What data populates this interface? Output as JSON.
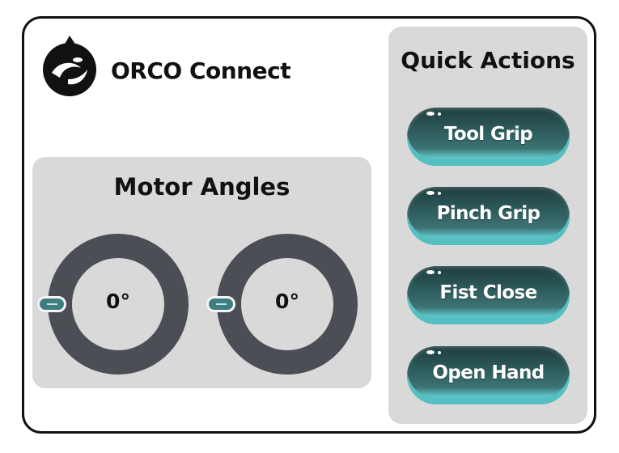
{
  "header": {
    "title": "ORCO Connect",
    "logo_icon": "orca-logo-icon"
  },
  "motors": {
    "title": "Motor Angles",
    "dials": [
      {
        "value": "0°",
        "angle_deg": 0
      },
      {
        "value": "0°",
        "angle_deg": 0
      }
    ]
  },
  "actions": {
    "title": "Quick Actions",
    "buttons": [
      {
        "label": "Tool Grip"
      },
      {
        "label": "Pinch Grip"
      },
      {
        "label": "Fist Close"
      },
      {
        "label": "Open Hand"
      }
    ]
  },
  "colors": {
    "dial_track": "#4b4f55",
    "knob": "#3f7e80",
    "button_accent": "#5fc4c7",
    "panel_bg": "#d9d9d9"
  }
}
